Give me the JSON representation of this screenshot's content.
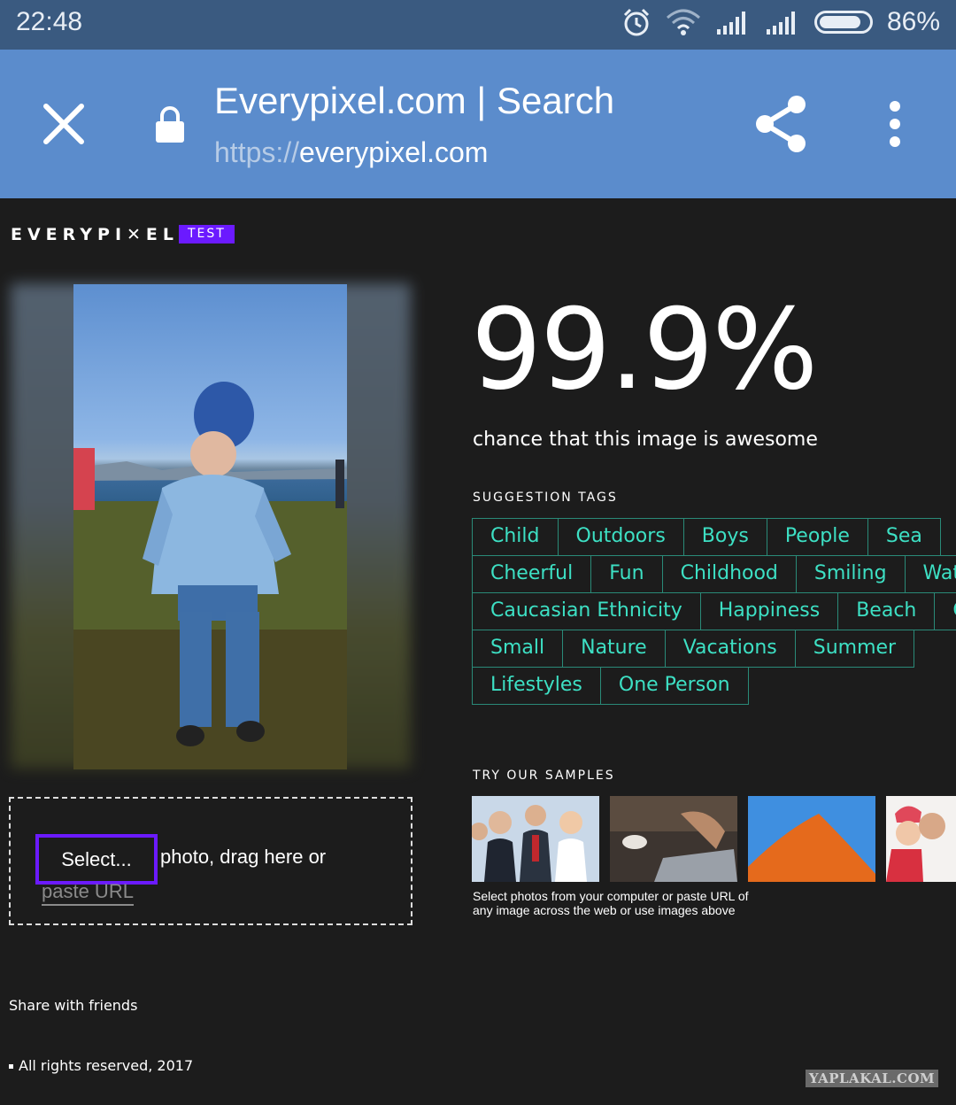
{
  "status_bar": {
    "time": "22:48",
    "battery_percent": "86%",
    "battery_level": 0.86,
    "icons": [
      "alarm-icon",
      "wifi-icon",
      "signal-icon",
      "signal-icon",
      "battery-icon"
    ]
  },
  "browser": {
    "title": "Everypixel.com | Search",
    "url_scheme": "https://",
    "url_host": "everypixel.com",
    "toolbar_color": "#5b8ccc",
    "icons": [
      "close-icon",
      "lock-icon",
      "share-icon",
      "more-vert-icon"
    ]
  },
  "header": {
    "logo": "EVERYPI✕EL",
    "badge": "TEST",
    "badge_color": "#6b1aff"
  },
  "upload": {
    "select_label": "Select...",
    "drag_text": "photo, drag here or",
    "paste_label": "paste URL"
  },
  "result": {
    "score": "99.9%",
    "caption": "chance that this image is awesome"
  },
  "tags": {
    "heading": "SUGGESTION TAGS",
    "accent_color": "#3de0c4",
    "rows": [
      [
        "Child",
        "Outdoors",
        "Boys",
        "People",
        "Sea"
      ],
      [
        "Cheerful",
        "Fun",
        "Childhood",
        "Smiling",
        "Water"
      ],
      [
        "Caucasian Ethnicity",
        "Happiness",
        "Beach",
        "Cute"
      ],
      [
        "Small",
        "Nature",
        "Vacations",
        "Summer"
      ],
      [
        "Lifestyles",
        "One Person"
      ]
    ]
  },
  "samples": {
    "heading": "TRY OUR SAMPLES",
    "caption": "Select photos from your computer or paste URL of any image across the web or use images above"
  },
  "footer": {
    "share": "Share with friends",
    "rights": "All rights reserved, 2017",
    "watermark": "YAPLAKAL.COM"
  }
}
